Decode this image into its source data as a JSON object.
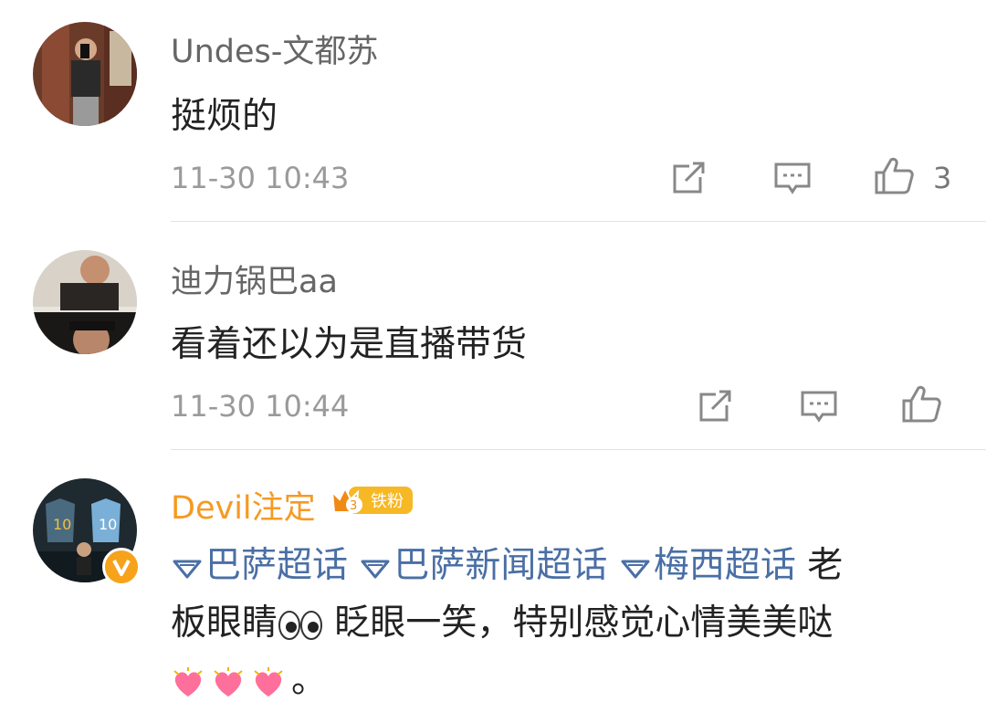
{
  "colors": {
    "username_gray": "#666666",
    "vip_name": "#f59a23",
    "topic_link": "#4a6fa5",
    "timestamp": "#9a9a9a",
    "divider": "#e2e2e2"
  },
  "comments": [
    {
      "username": "Undes-文都苏",
      "text": "挺烦的",
      "time": "11-30 10:43",
      "like_count": "3"
    },
    {
      "username": "迪力锅巴aa",
      "text": "看着还以为是直播带货",
      "time": "11-30 10:44",
      "like_count": ""
    },
    {
      "username": "Devil注定",
      "badge_label": "铁粉",
      "badge_level": "3",
      "topics": [
        "巴萨超话",
        "巴萨新闻超话",
        "梅西超话"
      ],
      "text_part1": "老",
      "text_line2a": "板眼睛",
      "text_line2b": " 眨眼一笑，特别感觉心情美美哒",
      "text_line3_end": "。"
    }
  ],
  "icons": {
    "share": "share-icon",
    "comment": "comment-icon",
    "like": "thumbs-up-icon",
    "topic": "diamond-topic-icon",
    "verified": "verified-v-icon",
    "eyes": "eyes-emoji",
    "heart": "heart-emoji"
  }
}
